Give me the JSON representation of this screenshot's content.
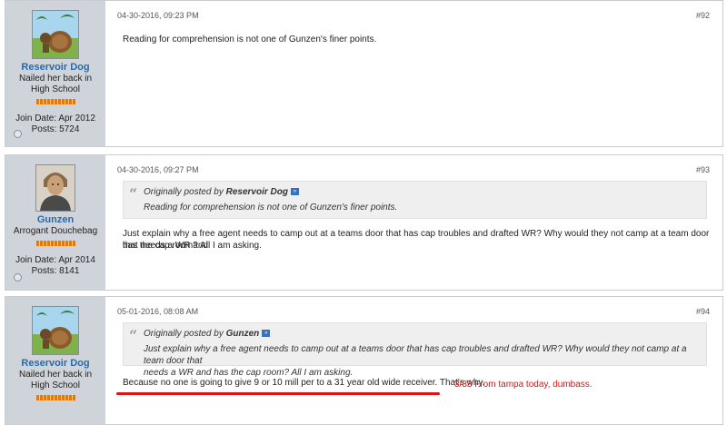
{
  "posts": [
    {
      "username": "Reservoir Dog",
      "title_line1": "Nailed her back in",
      "title_line2": "High School",
      "join_date": "Join Date: Apr 2012",
      "posts_count": "Posts: 5724",
      "date": "04-30-2016, 09:23 PM",
      "number": "#92",
      "message": "Reading for comprehension is not one of Gunzen's finer points."
    },
    {
      "username": "Gunzen",
      "title_line1": "Arrogant Douchebag",
      "join_date": "Join Date: Apr 2014",
      "posts_count": "Posts: 8141",
      "date": "04-30-2016, 09:27 PM",
      "number": "#93",
      "quote_prefix": "Originally posted by",
      "quote_author": "Reservoir Dog",
      "quote_text": "Reading for comprehension is not one of Gunzen's finer points.",
      "message_line1": "Just explain why a free agent needs to camp out at a teams door that has cap troubles and drafted WR? Why would they not camp at a team door that needs a WR and",
      "message_line2": "has the cap room? All I am asking."
    },
    {
      "username": "Reservoir Dog",
      "title_line1": "Nailed her back in",
      "title_line2": "High School",
      "date": "05-01-2016, 08:08 AM",
      "number": "#94",
      "quote_prefix": "Originally posted by",
      "quote_author": "Gunzen",
      "quote_line1": "Just explain why a free agent needs to camp out at a teams door that has cap troubles and drafted WR? Why would they not camp at a team door that",
      "quote_line2": "needs a WR and has the cap room? All I am asking.",
      "message": "Because no one is going to give 9 or 10 mill per to a 31 year old wide receiver. That's why."
    }
  ],
  "annotation": {
    "text": "3/33  From tampa today, dumbass.",
    "color": "#d81414"
  },
  "colors": {
    "sidebar_bg": "#cfd4da",
    "username": "#2b6aa8",
    "reputation": "#e07a10"
  }
}
